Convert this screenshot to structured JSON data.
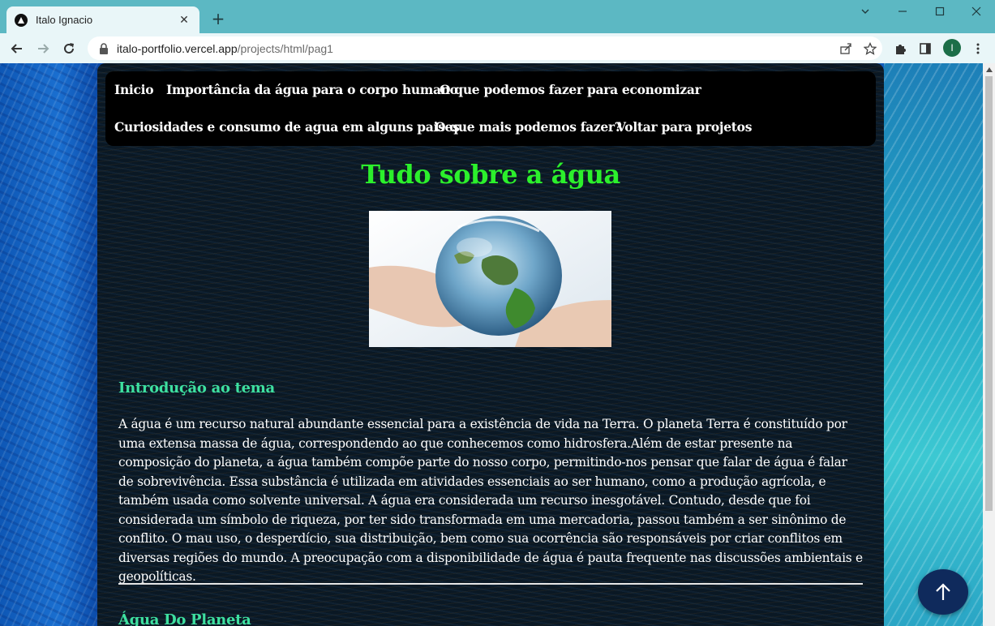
{
  "browser": {
    "tab_title": "Italo Ignacio",
    "tab_close": "✕",
    "new_tab": "+",
    "url_host": "italo-portfolio.vercel.app",
    "url_path": "/projects/html/pag1",
    "profile_initial": "I"
  },
  "nav": {
    "links": [
      "Inicio",
      "Importância da água para o corpo humano",
      "O que podemos fazer para economizar",
      "Curiosidades e consumo de agua em alguns paises",
      "O que mais podemos fazer?",
      "Voltar para projetos"
    ]
  },
  "main": {
    "title": "Tudo sobre a água",
    "sections": [
      {
        "heading": "Introdução ao tema",
        "text": "A água é um recurso natural abundante essencial para a existência de vida na Terra. O planeta Terra é constituído por uma extensa massa de água, correspondendo ao que conhecemos como hidrosfera.Além de estar presente na composição do planeta, a água também compõe parte do nosso corpo, permitindo-nos pensar que falar de água é falar de sobrevivência. Essa substância é utilizada em atividades essenciais ao ser humano, como a produção agrícola, e também usada como solvente universal. A água era considerada um recurso inesgotável. Contudo, desde que foi considerada um símbolo de riqueza, por ter sido transformada em uma mercadoria, passou também a ser sinônimo de conflito. O mau uso, o desperdício, sua distribuição, bem como sua ocorrência são responsáveis por criar conflitos em diversas regiões do mundo. A preocupação com a disponibilidade de água é pauta frequente nas discussões ambientais e geopolíticas."
      },
      {
        "heading": "Água Do Planeta"
      }
    ]
  },
  "colors": {
    "title": "#2cf02c",
    "heading": "#3ee0a0",
    "navbar": "#000000",
    "to_top_button": "#0f2a5c"
  },
  "icons": [
    "back-arrow-icon",
    "forward-arrow-icon",
    "reload-icon",
    "lock-icon",
    "share-icon",
    "star-icon",
    "extensions-icon",
    "side-panel-icon",
    "menu-dots-icon",
    "arrow-up-icon"
  ]
}
